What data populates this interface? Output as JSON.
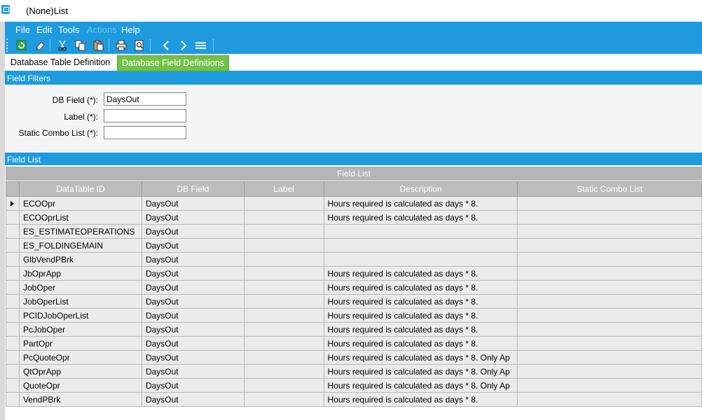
{
  "window": {
    "title": "(None)List"
  },
  "menu": [
    "File",
    "Edit",
    "Tools",
    "Actions",
    "Help"
  ],
  "toolbar": {
    "icons": [
      "refresh-icon",
      "clear-icon",
      "cut-icon",
      "copy-icon",
      "paste-icon",
      "print-icon",
      "print-preview-icon",
      "previous-icon",
      "next-icon",
      "list-icon"
    ]
  },
  "tabs": {
    "table_definition": "Database Table Definition",
    "field_definitions": "Database Field Definitions"
  },
  "filters": {
    "header": "Field Filters",
    "db_field_label": "DB Field (*):",
    "db_field_value": "DaysOut",
    "label_label": "Label (*):",
    "label_value": "",
    "combo_label": "Static Combo List (*):",
    "combo_value": ""
  },
  "field_list": {
    "header": "Field List",
    "caption": "Field List",
    "columns": [
      "DataTable ID",
      "DB Field",
      "Label",
      "Description",
      "Static Combo List"
    ],
    "rows": [
      [
        "ECOOpr",
        "DaysOut",
        "",
        "Hours required is calculated as days * 8.",
        ""
      ],
      [
        "ECOOprList",
        "DaysOut",
        "",
        "Hours required is calculated as days * 8.",
        ""
      ],
      [
        "ES_ESTIMATEOPERATIONS",
        "DaysOut",
        "",
        "",
        ""
      ],
      [
        "ES_FOLDINGEMAIN",
        "DaysOut",
        "",
        "",
        ""
      ],
      [
        "GlbVendPBrk",
        "DaysOut",
        "",
        "",
        ""
      ],
      [
        "JbOprApp",
        "DaysOut",
        "",
        "Hours required is calculated as days * 8.",
        ""
      ],
      [
        "JobOper",
        "DaysOut",
        "",
        "Hours required is calculated as days * 8.",
        ""
      ],
      [
        "JobOperList",
        "DaysOut",
        "",
        "Hours required is calculated as days * 8.",
        ""
      ],
      [
        "PCIDJobOperList",
        "DaysOut",
        "",
        "Hours required is calculated as days * 8.",
        ""
      ],
      [
        "PcJobOper",
        "DaysOut",
        "",
        "Hours required is calculated as days * 8.",
        ""
      ],
      [
        "PartOpr",
        "DaysOut",
        "",
        "Hours required is calculated as days * 8.",
        ""
      ],
      [
        "PcQuoteOpr",
        "DaysOut",
        "",
        "Hours required is calculated as days * 8. Only Ap",
        ""
      ],
      [
        "QtOprApp",
        "DaysOut",
        "",
        "Hours required is calculated as days * 8. Only Ap",
        ""
      ],
      [
        "QuoteOpr",
        "DaysOut",
        "",
        "Hours required is calculated as days * 8. Only Ap",
        ""
      ],
      [
        "VendPBrk",
        "DaysOut",
        "",
        "Hours required is calculated as days * 8.",
        ""
      ]
    ],
    "selected_row": 0
  },
  "colors": {
    "accent": "#1e9bdf",
    "active_tab": "#72c247"
  }
}
